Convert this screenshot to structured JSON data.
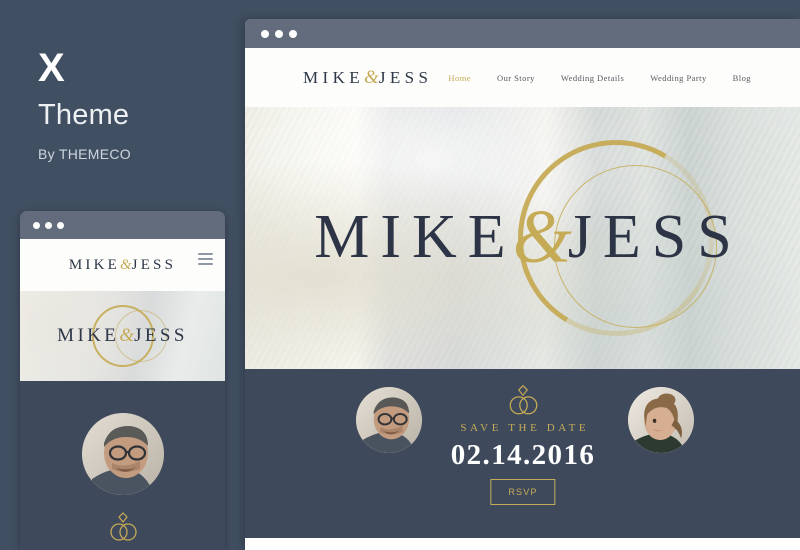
{
  "theme": {
    "logo_letter": "X",
    "name": "Theme",
    "author": "By THEMECO"
  },
  "colors": {
    "page_background": "#414f62",
    "site_dark": "#3e4a5c",
    "browser_chrome": "#636c7c",
    "gold_accent": "#c6ab56",
    "heading_navy": "#2c3446",
    "white": "#ffffff"
  },
  "desktop_preview": {
    "chrome": {
      "dots": 3
    },
    "site": {
      "logo": {
        "first": "MIKE",
        "amp": "&",
        "second": "JESS"
      },
      "nav": [
        {
          "label": "Home",
          "active": true
        },
        {
          "label": "Our Story",
          "active": false
        },
        {
          "label": "Wedding Details",
          "active": false
        },
        {
          "label": "Wedding Party",
          "active": false
        },
        {
          "label": "Blog",
          "active": false
        }
      ],
      "hero": {
        "first": "MIKE",
        "amp": "&",
        "second": "JESS"
      },
      "save_the_date": {
        "icon": "wedding-rings-icon",
        "label": "SAVE THE DATE",
        "date": "02.14.2016",
        "button": "RSVP"
      },
      "avatars": [
        {
          "name": "groom-avatar"
        },
        {
          "name": "bride-avatar"
        }
      ]
    }
  },
  "mobile_preview": {
    "chrome": {
      "dots": 3
    },
    "site": {
      "logo": {
        "first": "MIKE",
        "amp": "&",
        "second": "JESS"
      },
      "menu_icon": "hamburger-icon",
      "hero": {
        "first": "MIKE",
        "amp": "&",
        "second": "JESS"
      },
      "avatar": {
        "name": "groom-avatar"
      },
      "rings_icon": "wedding-rings-icon"
    }
  }
}
